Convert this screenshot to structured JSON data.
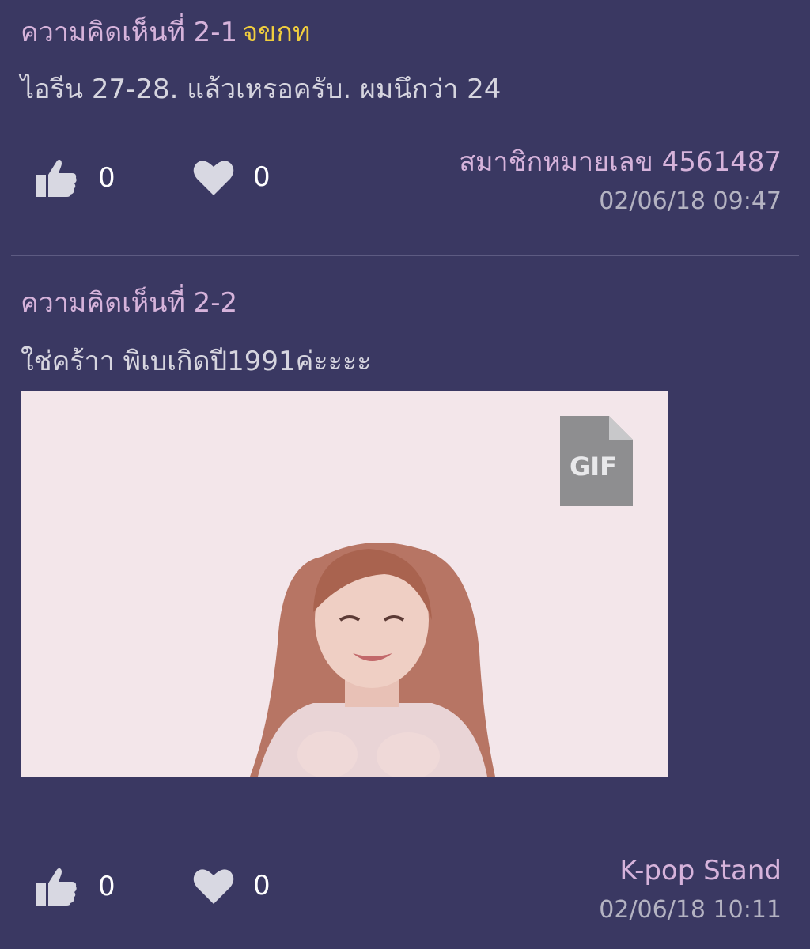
{
  "comments": [
    {
      "header": "ความคิดเห็นที่ 2-1",
      "tag": "จขกท",
      "body": "ไอรีน 27-28. แล้วเหรอครับ. ผมนึกว่า 24",
      "likes": "0",
      "hearts": "0",
      "author": "สมาชิกหมายเลข 4561487",
      "timestamp": "02/06/18 09:47"
    },
    {
      "header": "ความคิดเห็นที่ 2-2",
      "body": "ใช่คร้าา พิเบเกิดปี1991ค่ะะะะ",
      "image": {
        "badge": "GIF",
        "background": "#f3e6ea"
      },
      "likes": "0",
      "hearts": "0",
      "author": "K-pop Stand",
      "timestamp": "02/06/18 10:11"
    }
  ],
  "colors": {
    "background": "#3a3862",
    "header": "#d6b3db",
    "owner_tag": "#f0cd3e",
    "body_text": "#d6d5df",
    "icon": "#d8d8e2",
    "timestamp": "#b4b3c2",
    "divider": "#5d5b82"
  },
  "icons": {
    "like": "thumbs-up-icon",
    "heart": "heart-icon",
    "gif": "gif-file-icon"
  }
}
